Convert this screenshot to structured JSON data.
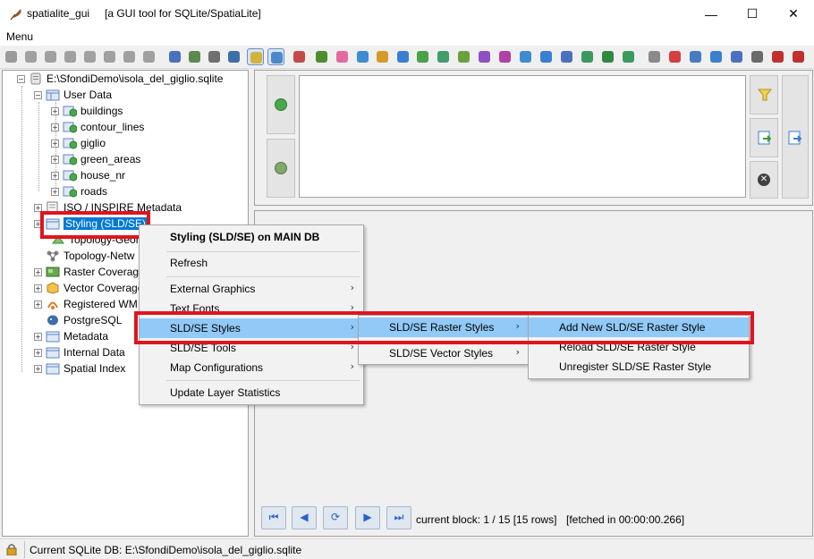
{
  "window": {
    "app_name": "spatialite_gui",
    "description": "[a GUI tool for SQLite/SpatiaLite]",
    "controls": {
      "minimize": "—",
      "maximize": "☐",
      "close": "✕"
    }
  },
  "menubar": {
    "menu": "Menu"
  },
  "toolbar": {
    "buttons": [
      {
        "icon": "connect-icon",
        "color": "#9a9a9a",
        "pressed": false
      },
      {
        "icon": "disconnect-icon",
        "color": "#a0a0a0",
        "pressed": false
      },
      {
        "icon": "db-icon",
        "color": "#a0a0a0",
        "pressed": false
      },
      {
        "icon": "db-new-icon",
        "color": "#a0a0a0",
        "pressed": false
      },
      {
        "icon": "db-memory-icon",
        "color": "#a0a0a0",
        "pressed": false
      },
      {
        "icon": "db-export-icon",
        "color": "#a0a0a0",
        "pressed": false
      },
      {
        "icon": "db-vacuum-icon",
        "color": "#a0a0a0",
        "pressed": false
      },
      {
        "icon": "db-attach-icon",
        "color": "#a0a0a0",
        "pressed": false
      },
      {
        "icon": "run-script-icon",
        "color": "#4a70c0",
        "pressed": false
      },
      {
        "icon": "load-shp-icon",
        "color": "#5b8a4f",
        "pressed": false
      },
      {
        "icon": "car-icon",
        "color": "#707070",
        "pressed": false
      },
      {
        "icon": "postgres-icon",
        "color": "#3d6fa8",
        "pressed": false
      },
      {
        "icon": "tree-view-icon",
        "color": "#d2b33c",
        "pressed": true
      },
      {
        "icon": "grid-view-icon",
        "color": "#4d88cc",
        "pressed": true
      },
      {
        "icon": "chart-icon",
        "color": "#c24a4a",
        "pressed": false
      },
      {
        "icon": "bug-icon",
        "color": "#4b8f2e",
        "pressed": false
      },
      {
        "icon": "flower-icon",
        "color": "#e36aa0",
        "pressed": false
      },
      {
        "icon": "import-icon",
        "color": "#3f8bd1",
        "pressed": false
      },
      {
        "icon": "import-xl-icon",
        "color": "#d49a2a",
        "pressed": false
      },
      {
        "icon": "dbf-icon",
        "color": "#3a7fd0",
        "pressed": false
      },
      {
        "icon": "globe-a-icon",
        "color": "#4aa14a",
        "pressed": false
      },
      {
        "icon": "globe-b-icon",
        "color": "#3f9e6a",
        "pressed": false
      },
      {
        "icon": "globe-c-icon",
        "color": "#6aa13f",
        "pressed": false
      },
      {
        "icon": "globe-d-icon",
        "color": "#8e4fc0",
        "pressed": false
      },
      {
        "icon": "globe-e-icon",
        "color": "#b13fa5",
        "pressed": false
      },
      {
        "icon": "export-a-icon",
        "color": "#3f8bd1",
        "pressed": false
      },
      {
        "icon": "export-b-icon",
        "color": "#3a7fd0",
        "pressed": false
      },
      {
        "icon": "export-c-icon",
        "color": "#4a70c0",
        "pressed": false
      },
      {
        "icon": "export-d-icon",
        "color": "#3c9a5f",
        "pressed": false
      },
      {
        "icon": "xls-icon",
        "color": "#2f8a3f",
        "pressed": false
      },
      {
        "icon": "table-export-icon",
        "color": "#3c9a5f",
        "pressed": false
      },
      {
        "icon": "eye-icon",
        "color": "#8a8a8a",
        "pressed": false
      },
      {
        "icon": "colors-icon",
        "color": "#d43f3f",
        "pressed": false
      },
      {
        "icon": "copy-icon",
        "color": "#4a7ac0",
        "pressed": false
      },
      {
        "icon": "map-icon",
        "color": "#3a7fd0",
        "pressed": false
      },
      {
        "icon": "wms-icon",
        "color": "#4a70c0",
        "pressed": false
      },
      {
        "icon": "network-icon",
        "color": "#6a6a6a",
        "pressed": false
      },
      {
        "icon": "pdf-icon",
        "color": "#c03030",
        "pressed": false
      },
      {
        "icon": "font-icon",
        "color": "#c03030",
        "pressed": false
      },
      {
        "icon": "help-icon",
        "color": "#3a7fd0",
        "pressed": false
      },
      {
        "icon": "info-icon",
        "color": "#3a5fd0",
        "pressed": false
      },
      {
        "icon": "about-icon",
        "color": "#3a7fd0",
        "pressed": false
      },
      {
        "icon": "exit-icon",
        "color": "#d4a02a",
        "pressed": false
      }
    ]
  },
  "tree": {
    "root": "E:\\SfondiDemo\\isola_del_giglio.sqlite",
    "user_data": "User Data",
    "layers": [
      "buildings",
      "contour_lines",
      "giglio",
      "green_areas",
      "house_nr",
      "roads"
    ],
    "iso_metadata": "ISO / INSPIRE Metadata",
    "styling": "Styling (SLD/SE)",
    "topology_geometries": "Topology-Geor",
    "topology_networks": "Topology-Netw",
    "raster_coverages": "Raster Coverage",
    "vector_coverages": "Vector Coverage",
    "registered_wms": "Registered WM",
    "postgresql": "PostgreSQL",
    "metadata": "Metadata",
    "internal_data": "Internal Data",
    "spatial_index": "Spatial Index"
  },
  "context_menu": {
    "header": "Styling (SLD/SE) on MAIN DB",
    "refresh": "Refresh",
    "external_graphics": "External Graphics",
    "text_fonts": "Text Fonts",
    "sld_se_styles": "SLD/SE Styles",
    "sld_se_tools": "SLD/SE Tools",
    "map_configurations": "Map Configurations",
    "update_layer_statistics": "Update Layer Statistics"
  },
  "submenu_styles": {
    "raster_styles": "SLD/SE Raster Styles",
    "vector_styles": "SLD/SE Vector Styles"
  },
  "submenu_raster": {
    "add_new": "Add New SLD/SE Raster Style",
    "reload": "Reload SLD/SE Raster Style",
    "unregister": "Unregister SLD/SE Raster Style"
  },
  "results": {
    "nav": {
      "first": "⏮",
      "prev": "◀",
      "refresh": "⟳",
      "next": "▶",
      "last": "⏭"
    },
    "current_block": "current block: 1 / 15 [15 rows]",
    "fetched": "[fetched in 00:00:00.266]"
  },
  "status": {
    "text": "Current SQLite DB: E:\\SfondiDemo\\isola_del_giglio.sqlite"
  },
  "colors": {
    "highlight_red": "#e0141e",
    "menu_highlight": "#91c9f7",
    "tree_selection": "#0078d7"
  }
}
